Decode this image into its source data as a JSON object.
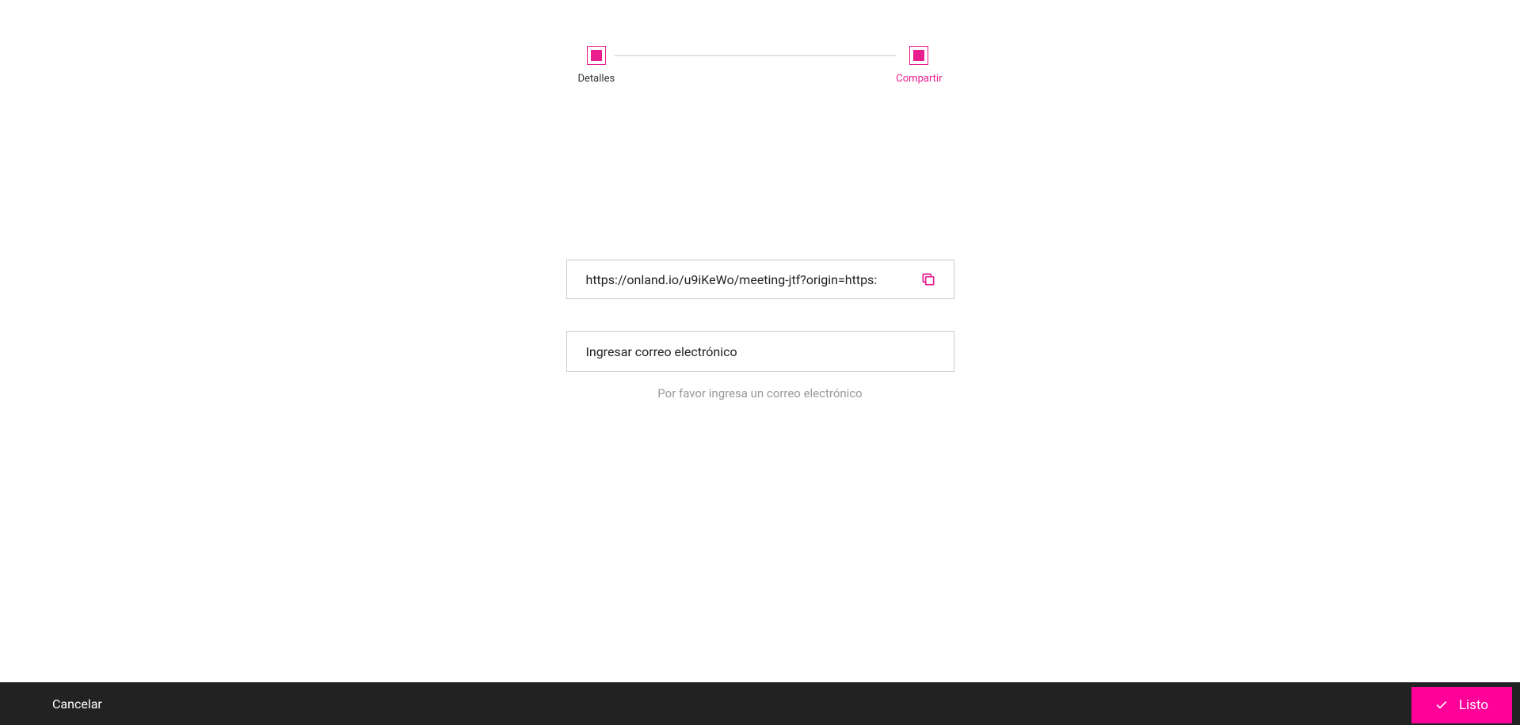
{
  "stepper": {
    "step1": {
      "label": "Detalles"
    },
    "step2": {
      "label": "Compartir"
    }
  },
  "form": {
    "url": "https://onland.io/u9iKeWo/meeting-jtf?origin=https:",
    "email_placeholder": "Ingresar correo electrónico",
    "helper_text": "Por favor ingresa un correo electrónico"
  },
  "footer": {
    "cancel_label": "Cancelar",
    "done_label": "Listo"
  }
}
